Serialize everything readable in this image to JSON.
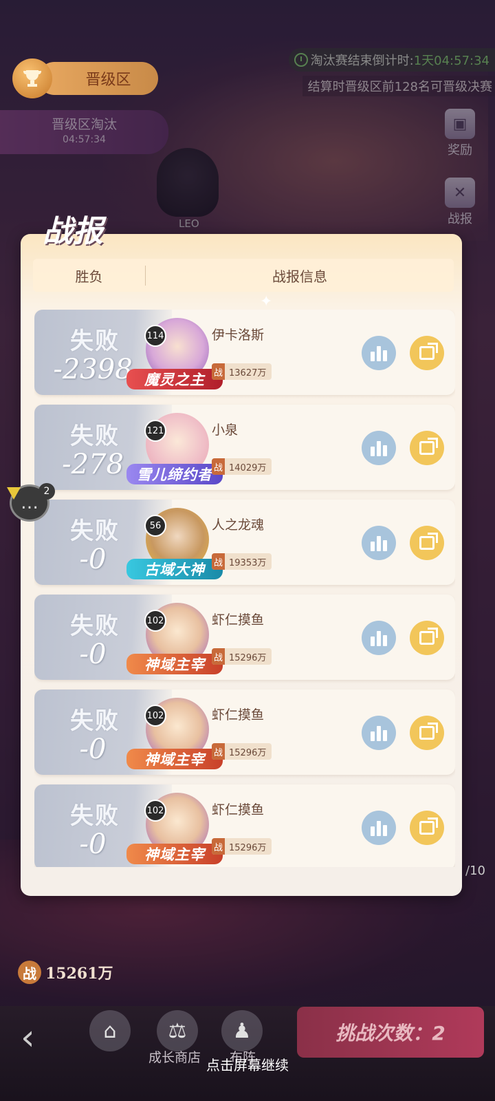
{
  "header": {
    "zone_label": "晋级区",
    "elimination_title": "晋级区淘汰",
    "elimination_timer": "04:57:34",
    "countdown_label": "淘汰赛结束倒计时:",
    "countdown_value": "1天04:57:34",
    "settle_note": "结算时晋级区前128名可晋级决赛"
  },
  "side_buttons": [
    {
      "label": "奖励",
      "icon": "treasure-chest-icon"
    },
    {
      "label": "战报",
      "icon": "crossed-swords-icon"
    }
  ],
  "hero": {
    "name": "LEO"
  },
  "report": {
    "title": "战报",
    "col_result": "胜负",
    "col_info": "战报信息",
    "rows": [
      {
        "result": "失败",
        "score": "-2398",
        "level": "114",
        "name": "伊卡洛斯",
        "power_tag": "战",
        "power": "13627万",
        "title_badge": "魔灵之主",
        "badge_color": "#d8343c"
      },
      {
        "result": "失败",
        "score": "-278",
        "level": "121",
        "name": "小泉",
        "power_tag": "战",
        "power": "14029万",
        "title_badge": "雪儿缔约者",
        "badge_color": "#7a6ae0"
      },
      {
        "result": "失败",
        "score": "-0",
        "level": "56",
        "name": "人之龙魂",
        "power_tag": "战",
        "power": "19353万",
        "title_badge": "古域大神",
        "badge_color": "#28b8d0"
      },
      {
        "result": "失败",
        "score": "-0",
        "level": "102",
        "name": "虾仁摸鱼",
        "power_tag": "战",
        "power": "15296万",
        "title_badge": "神域主宰",
        "badge_color": "#e0623a"
      },
      {
        "result": "失败",
        "score": "-0",
        "level": "102",
        "name": "虾仁摸鱼",
        "power_tag": "战",
        "power": "15296万",
        "title_badge": "神域主宰",
        "badge_color": "#e0623a"
      },
      {
        "result": "失败",
        "score": "-0",
        "level": "102",
        "name": "虾仁摸鱼",
        "power_tag": "战",
        "power": "15296万",
        "title_badge": "神域主宰",
        "badge_color": "#e0623a"
      }
    ]
  },
  "chat": {
    "count": "2"
  },
  "page_indicator": "/10",
  "player_power": {
    "tag": "战",
    "value": "15261万"
  },
  "bottom_nav": {
    "shop_label": "成长商店",
    "lineup_label": "布阵",
    "challenge_label": "挑战次数：2"
  },
  "tap_hint": "点击屏幕继续",
  "colors": {
    "accent": "#f2c65a",
    "stat_button": "#a8c4dc",
    "panel": "#fbf3e8"
  }
}
